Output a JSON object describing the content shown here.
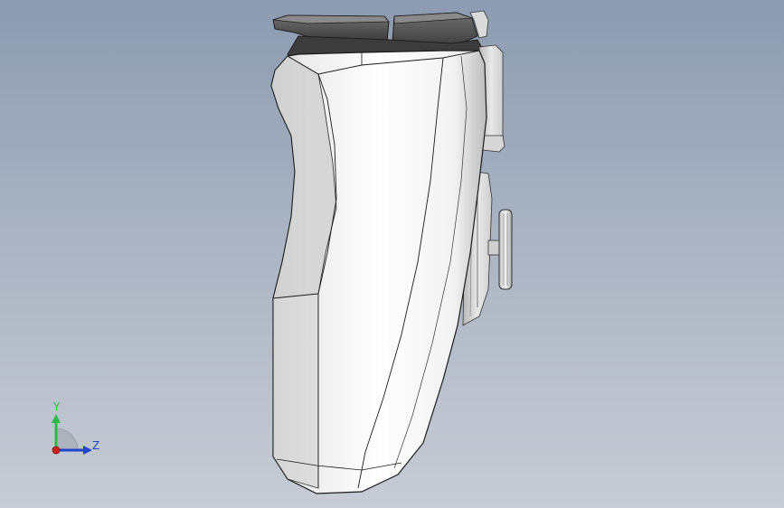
{
  "triad": {
    "y_label": "Y",
    "z_label": "Z",
    "colors": {
      "y_axis": "#2db84a",
      "z_axis": "#2244cc",
      "x_axis": "#d02020"
    }
  },
  "viewport": {
    "background_top": "#8c9bb1",
    "background_bottom": "#c7ccd5"
  }
}
